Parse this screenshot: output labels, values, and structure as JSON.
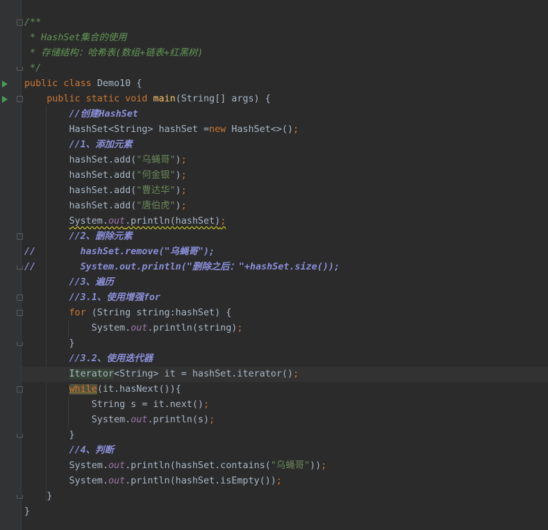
{
  "editor": {
    "lines": [
      {
        "id": "l1",
        "segs": [
          {
            "c": "doc",
            "t": "/**"
          }
        ]
      },
      {
        "id": "l2",
        "segs": [
          {
            "c": "doc",
            "t": " * HashSet集合的使用"
          }
        ]
      },
      {
        "id": "l3",
        "segs": [
          {
            "c": "doc",
            "t": " * 存储结构：哈希表(数组+链表+红黑树)"
          }
        ]
      },
      {
        "id": "l4",
        "segs": [
          {
            "c": "doc",
            "t": " */"
          }
        ]
      },
      {
        "id": "l5",
        "segs": [
          {
            "c": "kw",
            "t": "public class "
          },
          {
            "c": "",
            "t": "Demo10 {"
          }
        ]
      },
      {
        "id": "l6",
        "segs": [
          {
            "c": "",
            "t": "    "
          },
          {
            "c": "kw",
            "t": "public static void "
          },
          {
            "c": "fn",
            "t": "main"
          },
          {
            "c": "",
            "t": "(String[] args) {"
          }
        ]
      },
      {
        "id": "l7",
        "segs": [
          {
            "c": "",
            "t": "        "
          },
          {
            "c": "lc",
            "t": "//创建HashSet"
          }
        ]
      },
      {
        "id": "l8",
        "segs": [
          {
            "c": "",
            "t": "        HashSet<String> hashSet ="
          },
          {
            "c": "kw",
            "t": "new "
          },
          {
            "c": "",
            "t": "HashSet<>()"
          },
          {
            "c": "kw",
            "t": ";"
          }
        ]
      },
      {
        "id": "l9",
        "segs": [
          {
            "c": "",
            "t": "        "
          },
          {
            "c": "lc",
            "t": "//1、添加元素"
          }
        ]
      },
      {
        "id": "l10",
        "segs": [
          {
            "c": "",
            "t": "        hashSet.add("
          },
          {
            "c": "str",
            "t": "\"乌蝇哥\""
          },
          {
            "c": "",
            "t": ")"
          },
          {
            "c": "kw",
            "t": ";"
          }
        ]
      },
      {
        "id": "l11",
        "segs": [
          {
            "c": "",
            "t": "        hashSet.add("
          },
          {
            "c": "str",
            "t": "\"何金银\""
          },
          {
            "c": "",
            "t": ")"
          },
          {
            "c": "kw",
            "t": ";"
          }
        ]
      },
      {
        "id": "l12",
        "segs": [
          {
            "c": "",
            "t": "        hashSet.add("
          },
          {
            "c": "str",
            "t": "\"曹达华\""
          },
          {
            "c": "",
            "t": ")"
          },
          {
            "c": "kw",
            "t": ";"
          }
        ]
      },
      {
        "id": "l13",
        "segs": [
          {
            "c": "",
            "t": "        hashSet.add("
          },
          {
            "c": "str",
            "t": "\"唐伯虎\""
          },
          {
            "c": "",
            "t": ")"
          },
          {
            "c": "kw",
            "t": ";"
          }
        ]
      },
      {
        "id": "l14",
        "segs": [
          {
            "c": "",
            "t": "        "
          },
          {
            "c": "warn",
            "t": "System."
          },
          {
            "c": "stat warn",
            "t": "out"
          },
          {
            "c": "warn",
            "t": ".println(hashSet)"
          },
          {
            "c": "kw warn",
            "t": ";"
          }
        ]
      },
      {
        "id": "l15",
        "segs": [
          {
            "c": "",
            "t": "        "
          },
          {
            "c": "lc",
            "t": "//2、删除元素"
          }
        ]
      },
      {
        "id": "l16",
        "segs": [
          {
            "c": "cc",
            "t": "//        hashSet.remove(\"乌蝇哥\");"
          }
        ]
      },
      {
        "id": "l17",
        "segs": [
          {
            "c": "cc",
            "t": "//        System.out.println(\"删除之后：\"+hashSet.size());"
          }
        ]
      },
      {
        "id": "l18",
        "segs": [
          {
            "c": "",
            "t": "        "
          },
          {
            "c": "lc",
            "t": "//3、遍历"
          }
        ]
      },
      {
        "id": "l19",
        "segs": [
          {
            "c": "",
            "t": "        "
          },
          {
            "c": "lc",
            "t": "//3.1、使用增强for"
          }
        ]
      },
      {
        "id": "l20",
        "segs": [
          {
            "c": "",
            "t": "        "
          },
          {
            "c": "kw",
            "t": "for "
          },
          {
            "c": "",
            "t": "(String string:hashSet) {"
          }
        ]
      },
      {
        "id": "l21",
        "segs": [
          {
            "c": "",
            "t": "            System."
          },
          {
            "c": "stat",
            "t": "out"
          },
          {
            "c": "",
            "t": ".println(string)"
          },
          {
            "c": "kw",
            "t": ";"
          }
        ]
      },
      {
        "id": "l22",
        "segs": [
          {
            "c": "",
            "t": "        }"
          }
        ]
      },
      {
        "id": "l23",
        "segs": [
          {
            "c": "",
            "t": "        "
          },
          {
            "c": "lc",
            "t": "//3.2、使用迭代器"
          }
        ]
      },
      {
        "id": "l24",
        "segs": [
          {
            "c": "",
            "t": "        "
          },
          {
            "c": "hl-type",
            "t": "Iterator"
          },
          {
            "c": "",
            "t": "<String> it = hashSet.iterator()"
          },
          {
            "c": "kw",
            "t": ";"
          }
        ]
      },
      {
        "id": "l25",
        "segs": [
          {
            "c": "",
            "t": "        "
          },
          {
            "c": "kw hl-while",
            "t": "while"
          },
          {
            "c": "",
            "t": "(it.hasNext()){"
          }
        ]
      },
      {
        "id": "l26",
        "segs": [
          {
            "c": "",
            "t": "            String s = it.next()"
          },
          {
            "c": "kw",
            "t": ";"
          }
        ]
      },
      {
        "id": "l27",
        "segs": [
          {
            "c": "",
            "t": "            System."
          },
          {
            "c": "stat",
            "t": "out"
          },
          {
            "c": "",
            "t": ".println(s)"
          },
          {
            "c": "kw",
            "t": ";"
          }
        ]
      },
      {
        "id": "l28",
        "segs": [
          {
            "c": "",
            "t": "        }"
          }
        ]
      },
      {
        "id": "l29",
        "segs": [
          {
            "c": "",
            "t": "        "
          },
          {
            "c": "lc",
            "t": "//4、判断"
          }
        ]
      },
      {
        "id": "l30",
        "segs": [
          {
            "c": "",
            "t": "        System."
          },
          {
            "c": "stat",
            "t": "out"
          },
          {
            "c": "",
            "t": ".println(hashSet.contains("
          },
          {
            "c": "str",
            "t": "\"乌蝇哥\""
          },
          {
            "c": "",
            "t": "))"
          },
          {
            "c": "kw",
            "t": ";"
          }
        ]
      },
      {
        "id": "l31",
        "segs": [
          {
            "c": "",
            "t": "        System."
          },
          {
            "c": "stat",
            "t": "out"
          },
          {
            "c": "",
            "t": ".println(hashSet.isEmpty())"
          },
          {
            "c": "kw",
            "t": ";"
          }
        ]
      },
      {
        "id": "l32",
        "segs": [
          {
            "c": "",
            "t": "    }"
          }
        ]
      },
      {
        "id": "l33",
        "segs": [
          {
            "c": "",
            "t": "}"
          }
        ]
      }
    ],
    "current_line": "l24"
  },
  "gutter": {
    "run_markers": [
      "l5",
      "l6"
    ],
    "fold_open": [
      "l1",
      "l6",
      "l15",
      "l19",
      "l20",
      "l25"
    ],
    "fold_close": [
      "l4",
      "l17",
      "l22",
      "l28",
      "l32"
    ]
  },
  "colors": {
    "background": "#2b2b2b",
    "keyword": "#cc7832",
    "string": "#6a8759",
    "method": "#ffc66d",
    "static_field": "#9876aa",
    "doc_comment": "#629755",
    "line_comment": "#8a8fd8",
    "run_marker": "#499c54"
  }
}
